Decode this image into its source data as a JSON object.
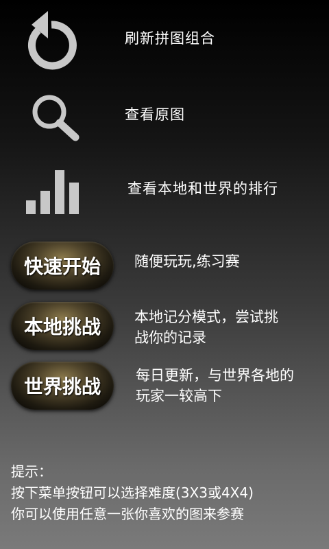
{
  "menu": {
    "refresh_label": "刷新拼图组合",
    "view_original_label": "查看原图",
    "ranking_label": "查看本地和世界的排行"
  },
  "modes": [
    {
      "button": "快速开始",
      "desc_line1": "随便玩玩,练习赛",
      "desc_line2": ""
    },
    {
      "button": "本地挑战",
      "desc_line1": "本地记分模式，尝试挑",
      "desc_line2": "战你的记录"
    },
    {
      "button": "世界挑战",
      "desc_line1": "每日更新，与世界各地的",
      "desc_line2": "玩家一较高下"
    }
  ],
  "tips": {
    "title": "提示：",
    "line1": "按下菜单按钮可以选择难度(3X3或4X4)",
    "line2": "你可以使用任意一张你喜欢的图来参赛"
  },
  "icons": [
    "refresh-icon",
    "search-icon",
    "bar-chart-icon"
  ],
  "colors": {
    "icon_gray": "#c8c8c8",
    "button_gold": "#8c7a4c"
  }
}
